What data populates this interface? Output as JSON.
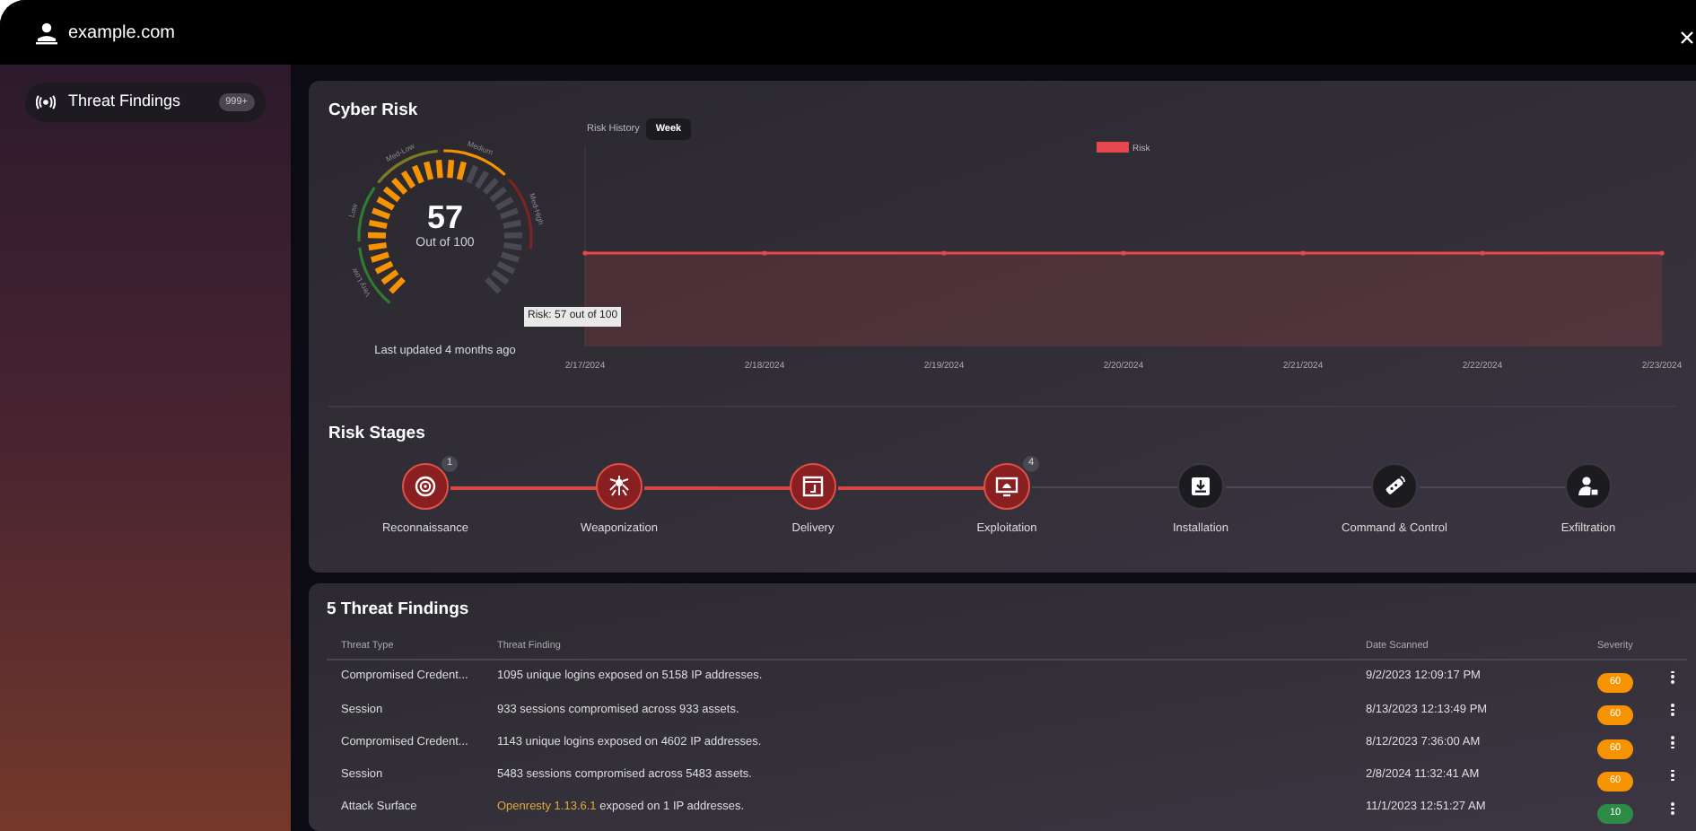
{
  "window": {
    "title": "example.com"
  },
  "sidebar": {
    "items": [
      {
        "label": "Threat Findings",
        "badge": "999+",
        "selected": true
      }
    ]
  },
  "cyber_risk": {
    "title": "Cyber Risk",
    "gauge": {
      "score": "57",
      "caption": "Out of 100",
      "level": 0.57,
      "updated": "Last updated 4 months ago",
      "bands": [
        {
          "label": "Very Low",
          "color": "#2e7d32"
        },
        {
          "label": "Low",
          "color": "#2e7d32"
        },
        {
          "label": "Med-Low",
          "color": "#7d7a22"
        },
        {
          "label": "Medium",
          "color": "#f59300"
        },
        {
          "label": "Med-High",
          "color": "#7a2424"
        }
      ]
    },
    "tooltip": "Risk: 57 out of 100",
    "history": {
      "label": "Risk History",
      "range": "Week",
      "legend": "Risk",
      "x_labels": [
        "2/17/2024",
        "2/18/2024",
        "2/19/2024",
        "2/20/2024",
        "2/21/2024",
        "2/22/2024",
        "2/23/2024"
      ]
    }
  },
  "risk_stages": {
    "title": "Risk Stages",
    "stages": [
      {
        "label": "Reconnaissance",
        "active": true,
        "count": "1"
      },
      {
        "label": "Weaponization",
        "active": true
      },
      {
        "label": "Delivery",
        "active": true
      },
      {
        "label": "Exploitation",
        "active": true,
        "count": "4"
      },
      {
        "label": "Installation",
        "active": false
      },
      {
        "label": "Command & Control",
        "active": false
      },
      {
        "label": "Exfiltration",
        "active": false
      }
    ]
  },
  "findings": {
    "title": "5 Threat Findings",
    "columns": [
      "Threat Type",
      "Threat Finding",
      "Date Scanned",
      "Severity"
    ],
    "rows": [
      {
        "type": "Compromised Credent...",
        "finding": "1095 unique logins exposed on 5158 IP addresses.",
        "date": "9/2/2023 12:09:17 PM",
        "severity": "60",
        "color": "#f59300"
      },
      {
        "type": "Session",
        "finding": "933 sessions compromised across 933 assets.",
        "date": "8/13/2023 12:13:49 PM",
        "severity": "60",
        "color": "#f59300"
      },
      {
        "type": "Compromised Credent...",
        "finding": "1143 unique logins exposed on 4602 IP addresses.",
        "date": "8/12/2023 7:36:00 AM",
        "severity": "60",
        "color": "#f59300"
      },
      {
        "type": "Session",
        "finding": "5483 sessions compromised across 5483 assets.",
        "date": "2/8/2024 11:32:41 AM",
        "severity": "60",
        "color": "#f59300"
      },
      {
        "type": "Attack Surface",
        "finding_link": "Openresty 1.13.6.1",
        "finding": "exposed on 1 IP addresses.",
        "date": "11/1/2023 12:51:27 AM",
        "severity": "10",
        "color": "#2e8b47"
      }
    ]
  }
}
